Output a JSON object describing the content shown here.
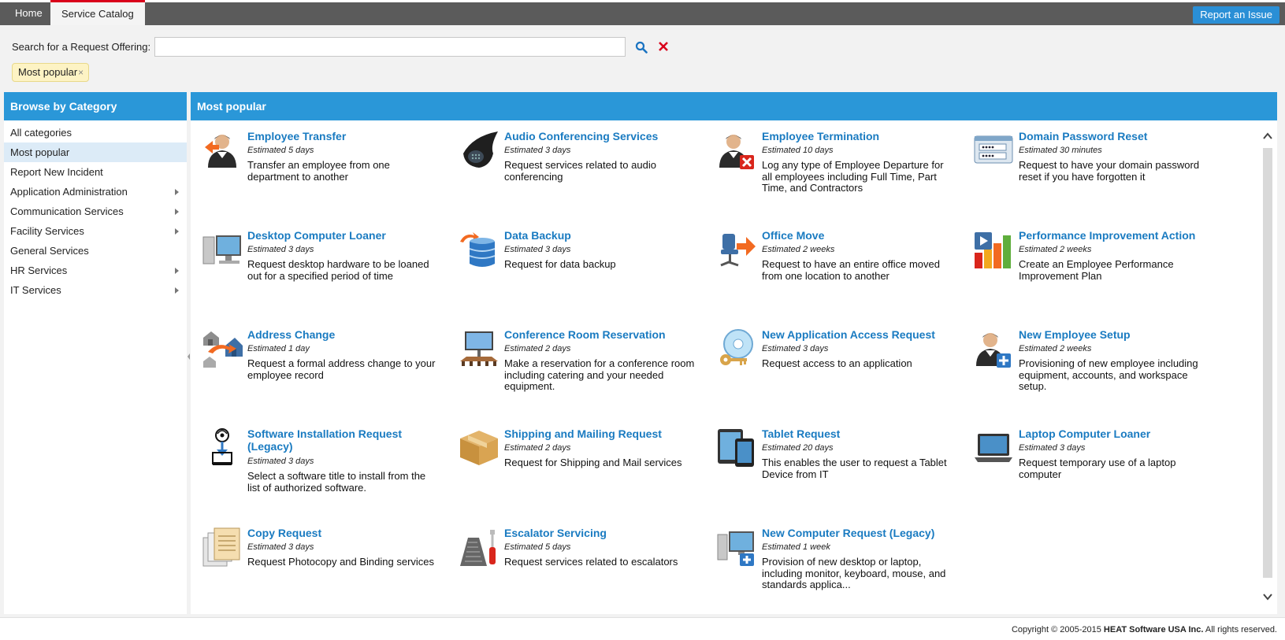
{
  "tabs": [
    {
      "label": "Home"
    },
    {
      "label": "Service Catalog"
    }
  ],
  "report_button": "Report an Issue",
  "search": {
    "label": "Search for a Request Offering:",
    "value": "",
    "placeholder": ""
  },
  "filter_chip": {
    "label": "Most popular",
    "remove": "×"
  },
  "sidebar": {
    "title": "Browse by Category",
    "items": [
      {
        "label": "All categories",
        "has_children": false
      },
      {
        "label": "Most popular",
        "has_children": false,
        "selected": true
      },
      {
        "label": "Report New Incident",
        "has_children": false
      },
      {
        "label": "Application Administration",
        "has_children": true
      },
      {
        "label": "Communication Services",
        "has_children": true
      },
      {
        "label": "Facility Services",
        "has_children": true
      },
      {
        "label": "General Services",
        "has_children": false
      },
      {
        "label": "HR Services",
        "has_children": true
      },
      {
        "label": "IT Services",
        "has_children": true
      }
    ]
  },
  "main": {
    "title": "Most popular",
    "offerings": [
      {
        "title": "Employee Transfer",
        "estimate": "Estimated 5 days",
        "description": "Transfer an employee from one department to another",
        "icon": "person-arrow-icon"
      },
      {
        "title": "Audio Conferencing Services",
        "estimate": "Estimated 3 days",
        "description": "Request services related to audio conferencing",
        "icon": "conference-phone-icon"
      },
      {
        "title": "Employee Termination",
        "estimate": "Estimated 10 days",
        "description": "Log any type of Employee Departure for all employees including Full Time, Part Time, and Contractors",
        "icon": "person-remove-icon"
      },
      {
        "title": "Domain Password Reset",
        "estimate": "Estimated 30 minutes",
        "description": "Request to have your domain password reset if you have forgotten it",
        "icon": "password-field-icon"
      },
      {
        "title": "Desktop Computer Loaner",
        "estimate": "Estimated 3 days",
        "description": "Request desktop hardware to be loaned out for a specified period of time",
        "icon": "desktop-computer-icon"
      },
      {
        "title": "Data Backup",
        "estimate": "Estimated 3 days",
        "description": "Request for data backup",
        "icon": "database-backup-icon"
      },
      {
        "title": "Office Move",
        "estimate": "Estimated 2 weeks",
        "description": "Request to have an entire office moved from one location to another",
        "icon": "office-chair-move-icon"
      },
      {
        "title": "Performance Improvement Action",
        "estimate": "Estimated 2 weeks",
        "description": "Create an Employee Performance Improvement Plan",
        "icon": "bar-chart-play-icon"
      },
      {
        "title": "Address Change",
        "estimate": "Estimated 1 day",
        "description": "Request a formal address change to your employee record",
        "icon": "house-move-icon"
      },
      {
        "title": "Conference Room Reservation",
        "estimate": "Estimated 2 days",
        "description": "Make a reservation for a conference room including catering and your needed equipment.",
        "icon": "conference-room-icon"
      },
      {
        "title": "New Application Access Request",
        "estimate": "Estimated 3 days",
        "description": "Request access to an application",
        "icon": "disc-key-icon"
      },
      {
        "title": "New Employee Setup",
        "estimate": "Estimated 2 weeks",
        "description": "Provisioning of new employee including equipment, accounts, and workspace setup.",
        "icon": "person-add-icon"
      },
      {
        "title": "Software Installation Request (Legacy)",
        "estimate": "Estimated 3 days",
        "description": "Select a software title to install from the list of authorized software.",
        "icon": "software-install-icon"
      },
      {
        "title": "Shipping and Mailing Request",
        "estimate": "Estimated 2 days",
        "description": "Request for Shipping and Mail services",
        "icon": "package-box-icon"
      },
      {
        "title": "Tablet Request",
        "estimate": "Estimated 20 days",
        "description": "This enables the user to request a Tablet Device from IT",
        "icon": "tablet-devices-icon"
      },
      {
        "title": "Laptop Computer Loaner",
        "estimate": "Estimated 3 days",
        "description": "Request temporary use of a laptop computer",
        "icon": "laptop-icon"
      },
      {
        "title": "Copy Request",
        "estimate": "Estimated 3 days",
        "description": "Request Photocopy and Binding services",
        "icon": "document-copies-icon"
      },
      {
        "title": "Escalator Servicing",
        "estimate": "Estimated 5 days",
        "description": "Request services related to escalators",
        "icon": "escalator-tool-icon"
      },
      {
        "title": "New Computer Request (Legacy)",
        "estimate": "Estimated 1 week",
        "description": "Provision of new desktop or laptop, including monitor, keyboard, mouse, and standards applica...",
        "icon": "computer-add-icon"
      }
    ]
  },
  "footer": {
    "prefix": "Copyright © 2005-2015 ",
    "company": "HEAT Software USA Inc.",
    "suffix": " All rights reserved."
  },
  "colors": {
    "accent": "#2a97d8",
    "link": "#1a7bc1",
    "topbar": "#5b5b5b",
    "active_tab_border": "#d9001b"
  }
}
